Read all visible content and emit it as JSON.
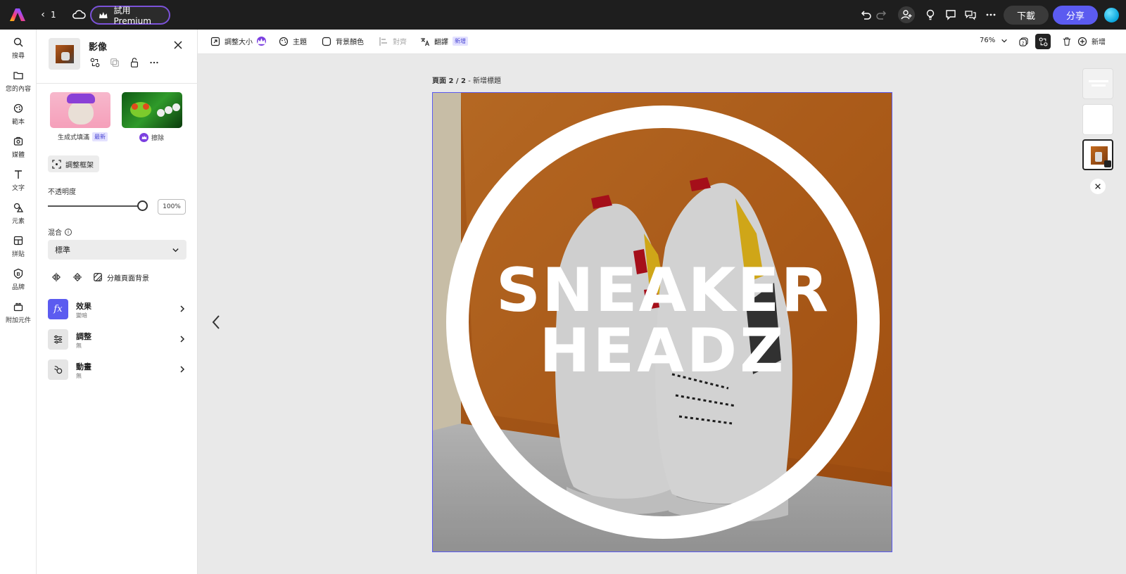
{
  "topbar": {
    "page_count": "1",
    "premium_label": "試用 Premium",
    "download_label": "下載",
    "share_label": "分享"
  },
  "rail": {
    "items": [
      {
        "label": "搜尋",
        "icon": "search-icon"
      },
      {
        "label": "您的內容",
        "icon": "folder-icon"
      },
      {
        "label": "範本",
        "icon": "template-icon"
      },
      {
        "label": "媒體",
        "icon": "media-icon"
      },
      {
        "label": "文字",
        "icon": "text-icon"
      },
      {
        "label": "元素",
        "icon": "shapes-icon"
      },
      {
        "label": "拼貼",
        "icon": "grid-icon"
      },
      {
        "label": "品牌",
        "icon": "brand-icon"
      },
      {
        "label": "附加元件",
        "icon": "addon-icon"
      }
    ]
  },
  "panel": {
    "title": "影像",
    "gen_fill_label": "生成式填滿",
    "gen_fill_badge": "最新",
    "erase_label": "擦除",
    "crop_label": "調整框架",
    "opacity_label": "不透明度",
    "opacity_value": "100%",
    "opacity_fraction": 1.0,
    "blend_label": "混合",
    "blend_value": "標準",
    "remove_bg_label": "分離頁面背景",
    "effects_title": "效果",
    "effects_sub": "變暗",
    "adjust_title": "調整",
    "adjust_sub": "無",
    "animation_title": "動畫",
    "animation_sub": "無"
  },
  "canvas_toolbar": {
    "resize_label": "調整大小",
    "theme_label": "主題",
    "bg_color_label": "背景顏色",
    "align_label": "對齊",
    "translate_label": "翻譯",
    "translate_badge": "新增",
    "zoom_value": "76%",
    "add_label": "新增"
  },
  "canvas": {
    "page_label_prefix": "頁面 2 / 2",
    "page_label_sep": " - ",
    "page_label_title": "新增標題",
    "headline_line1": "SNEAKER",
    "headline_line2": "HEADZ"
  },
  "colors": {
    "accent": "#5b5bf0",
    "premium_border": "#7b52d9",
    "wall_orange": "#c46a1c"
  }
}
